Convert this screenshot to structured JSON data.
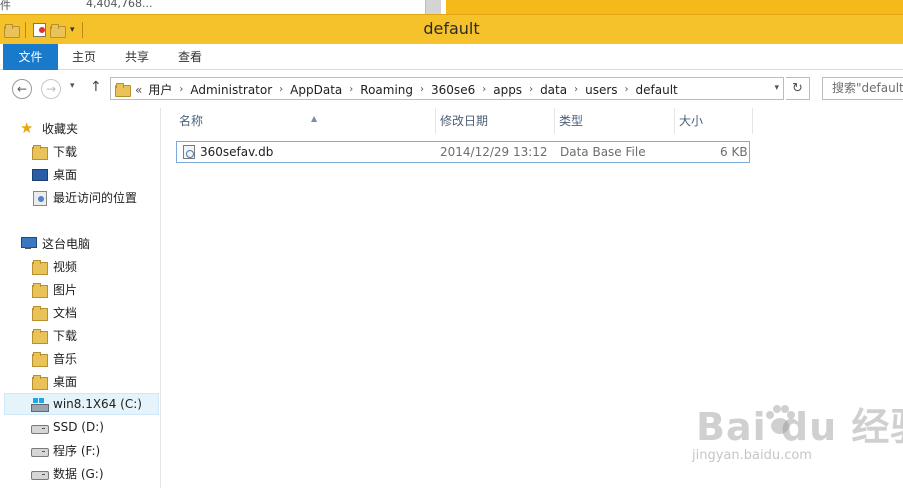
{
  "background": {
    "left_label": "件",
    "size_label": "4,404,768..."
  },
  "quick_access": {
    "dropdown_glyph": "▾"
  },
  "window": {
    "title": "default"
  },
  "ribbon": {
    "tabs": [
      {
        "label": "文件",
        "active": true
      },
      {
        "label": "主页"
      },
      {
        "label": "共享"
      },
      {
        "label": "查看"
      }
    ]
  },
  "navigation": {
    "back_glyph": "←",
    "forward_glyph": "→",
    "recent_glyph": "▾",
    "up_glyph": "↑",
    "lead": "«",
    "crumbs": [
      "用户",
      "Administrator",
      "AppData",
      "Roaming",
      "360se6",
      "apps",
      "data",
      "users",
      "default"
    ],
    "separator": "›",
    "dropdown_glyph": "▾",
    "refresh_glyph": "↻",
    "search_placeholder": "搜索\"default\""
  },
  "sidebar": {
    "favorites": {
      "label": "收藏夹",
      "items": [
        "下载",
        "桌面",
        "最近访问的位置"
      ]
    },
    "this_pc": {
      "label": "这台电脑",
      "items": [
        "视频",
        "图片",
        "文档",
        "下载",
        "音乐",
        "桌面"
      ]
    },
    "drives": [
      {
        "label": "win8.1X64 (C:)",
        "selected": true
      },
      {
        "label": "SSD (D:)"
      },
      {
        "label": "程序 (F:)"
      },
      {
        "label": "数据 (G:)"
      }
    ],
    "expand_glyph": "▸"
  },
  "columns": {
    "name": "名称",
    "date": "修改日期",
    "type": "类型",
    "size": "大小",
    "sort_glyph": "▲"
  },
  "files": [
    {
      "name": "360sefav.db",
      "date": "2014/12/29 13:12",
      "type": "Data Base File",
      "size": "6 KB"
    }
  ],
  "watermark": {
    "brand": "Bai  du 经验",
    "url": "jingyan.baidu.com"
  },
  "colors": {
    "title_bar": "#f5c22c",
    "file_tab": "#1979ca",
    "selection_border": "#7dabd9",
    "column_header_text": "#4c607a"
  }
}
